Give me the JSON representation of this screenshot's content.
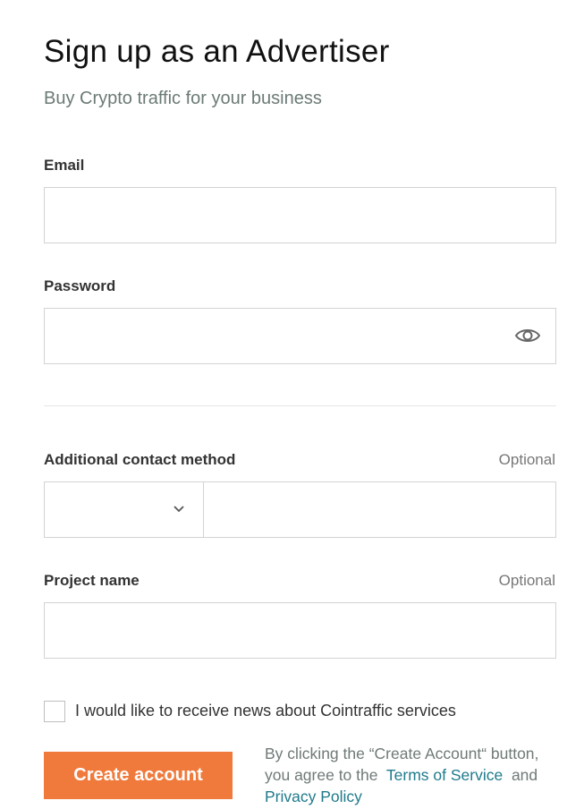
{
  "header": {
    "title": "Sign up as an Advertiser",
    "subtitle": "Buy Crypto traffic for your business"
  },
  "form": {
    "email": {
      "label": "Email",
      "value": "",
      "placeholder": ""
    },
    "password": {
      "label": "Password",
      "value": "",
      "placeholder": "",
      "toggle_icon": "eye-icon"
    },
    "contact": {
      "label": "Additional contact method",
      "optional": "Optional",
      "selected": "",
      "value": "",
      "dropdown_icon": "chevron-down-icon"
    },
    "project": {
      "label": "Project name",
      "optional": "Optional",
      "value": "",
      "placeholder": ""
    },
    "newsletter": {
      "label": "I would like to receive news about Cointraffic services",
      "checked": false
    }
  },
  "actions": {
    "create_label": "Create account"
  },
  "legal": {
    "prefix": "By clicking the “Create Account“ button, you agree to the",
    "terms": "Terms of Service",
    "and": "and",
    "privacy": "Privacy Policy"
  },
  "colors": {
    "accent": "#f07a3c",
    "link": "#1f7a8c",
    "subtitle": "#6b7a76"
  }
}
